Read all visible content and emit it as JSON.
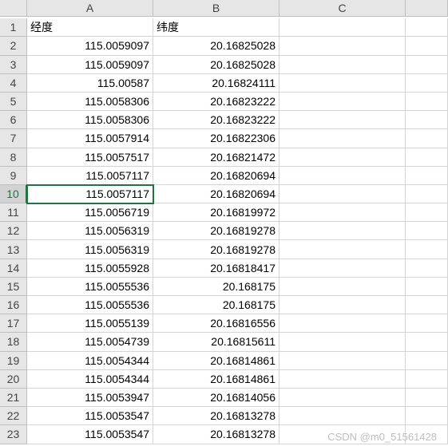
{
  "columns": [
    "A",
    "B",
    "C"
  ],
  "headers": {
    "A": "经度",
    "B": "纬度",
    "C": ""
  },
  "active_row": 10,
  "rows": [
    {
      "n": 1,
      "A": "经度",
      "B": "纬度",
      "C": "",
      "header": true
    },
    {
      "n": 2,
      "A": "115.0059097",
      "B": "20.16825028",
      "C": ""
    },
    {
      "n": 3,
      "A": "115.0059097",
      "B": "20.16825028",
      "C": ""
    },
    {
      "n": 4,
      "A": "115.00587",
      "B": "20.16824111",
      "C": ""
    },
    {
      "n": 5,
      "A": "115.0058306",
      "B": "20.16823222",
      "C": ""
    },
    {
      "n": 6,
      "A": "115.0058306",
      "B": "20.16823222",
      "C": ""
    },
    {
      "n": 7,
      "A": "115.0057914",
      "B": "20.16822306",
      "C": ""
    },
    {
      "n": 8,
      "A": "115.0057517",
      "B": "20.16821472",
      "C": ""
    },
    {
      "n": 9,
      "A": "115.0057117",
      "B": "20.16820694",
      "C": ""
    },
    {
      "n": 10,
      "A": "115.0057117",
      "B": "20.16820694",
      "C": ""
    },
    {
      "n": 11,
      "A": "115.0056719",
      "B": "20.16819972",
      "C": ""
    },
    {
      "n": 12,
      "A": "115.0056319",
      "B": "20.16819278",
      "C": ""
    },
    {
      "n": 13,
      "A": "115.0056319",
      "B": "20.16819278",
      "C": ""
    },
    {
      "n": 14,
      "A": "115.0055928",
      "B": "20.16818417",
      "C": ""
    },
    {
      "n": 15,
      "A": "115.0055536",
      "B": "20.168175",
      "C": ""
    },
    {
      "n": 16,
      "A": "115.0055536",
      "B": "20.168175",
      "C": ""
    },
    {
      "n": 17,
      "A": "115.0055139",
      "B": "20.16816556",
      "C": ""
    },
    {
      "n": 18,
      "A": "115.0054739",
      "B": "20.16815611",
      "C": ""
    },
    {
      "n": 19,
      "A": "115.0054344",
      "B": "20.16814861",
      "C": ""
    },
    {
      "n": 20,
      "A": "115.0054344",
      "B": "20.16814861",
      "C": ""
    },
    {
      "n": 21,
      "A": "115.0053947",
      "B": "20.16814056",
      "C": ""
    },
    {
      "n": 22,
      "A": "115.0053547",
      "B": "20.16813278",
      "C": ""
    },
    {
      "n": 23,
      "A": "115.0053547",
      "B": "20.16813278",
      "C": ""
    }
  ],
  "watermark": "CSDN @m0_51561428"
}
